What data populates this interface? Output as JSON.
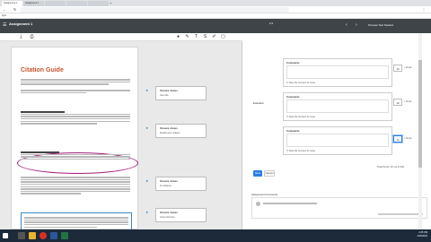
{
  "browser": {
    "tabs": [
      "Assignment 1",
      "Assignment 1",
      "",
      "",
      ""
    ],
    "url": "",
    "bookmarks": [
      "Apps",
      "",
      "",
      "",
      "",
      "",
      "",
      "",
      "",
      ""
    ]
  },
  "header": {
    "title": "Assignment 1",
    "subtitle": "",
    "count": "1/1",
    "student": "Preview Test Student"
  },
  "doc": {
    "title": "Citation Guide"
  },
  "comments": [
    {
      "who": "Unsure Jones",
      "text": "nice title"
    },
    {
      "who": "Unsure Jones",
      "text": "fix/add your citation"
    },
    {
      "who": "Unsure Jones",
      "text": "fix citations"
    },
    {
      "who": "Unsure Jones",
      "text": "more info here"
    }
  ],
  "rubric": {
    "criteria": [
      {
        "label": "",
        "link": "",
        "comment_title": "Comments",
        "checkbox": "Save this comment for reuse",
        "points": "10",
        "max": "/ 10 pts"
      },
      {
        "label": "Evaluation",
        "link": "",
        "comment_title": "Comments",
        "checkbox": "Save this comment for reuse",
        "points": "10",
        "max": "/ 10 pts"
      },
      {
        "label": "",
        "link": "",
        "comment_title": "Comments",
        "checkbox": "Save this comment for reuse",
        "points": "10",
        "max": "/ 10 pts"
      }
    ],
    "total": "Total Points: 30 out of 330",
    "save": "Save",
    "cancel": "Cancel"
  },
  "assignment_comments": {
    "title": "Assignment Comments"
  },
  "taskbar": {
    "time": "2:25 PM",
    "date": "4/15/2020"
  }
}
